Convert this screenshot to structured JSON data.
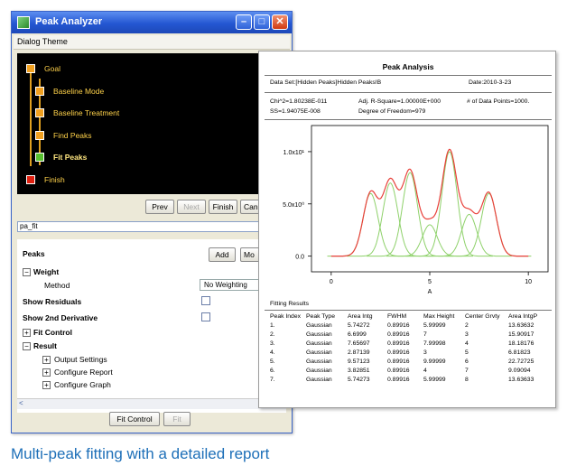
{
  "window": {
    "title": "Peak Analyzer",
    "theme_label": "Dialog Theme",
    "steps": [
      {
        "label": "Goal",
        "color": "#f0a020"
      },
      {
        "label": "Baseline Mode",
        "color": "#f0a020"
      },
      {
        "label": "Baseline Treatment",
        "color": "#f0a020"
      },
      {
        "label": "Find Peaks",
        "color": "#f0a020"
      },
      {
        "label": "Fit Peaks",
        "color": "#58c030"
      },
      {
        "label": "Finish",
        "color": "#e02010"
      }
    ],
    "nav": {
      "prev": "Prev",
      "next": "Next",
      "finish": "Finish",
      "cancel": "Canc"
    },
    "theme_name": "pa_fit",
    "peaks_label": "Peaks",
    "add_label": "Add",
    "more_label": "Mo",
    "weight_label": "Weight",
    "method_label": "Method",
    "method_value": "No Weighting",
    "show_residuals": "Show Residuals",
    "show_2nd_derivative": "Show 2nd Derivative",
    "fit_control": "Fit Control",
    "result": "Result",
    "result_items": [
      "Output Settings",
      "Configure Report",
      "Configure Graph"
    ],
    "bottom_fit_control": "Fit Control",
    "bottom_fit": "Fit"
  },
  "report": {
    "title": "Peak Analysis",
    "data_set": "Data Set:[Hidden Peaks]Hidden Peaks!B",
    "date": "Date:2010-3-23",
    "chi2": "Chi^2=1.80238E-011",
    "adj_r2": "Adj. R-Square=1.00000E+000",
    "num_points": "# of Data Points=1000.",
    "ss": "SS=1.94075E-008",
    "dof": "Degree of Freedom=979",
    "fitting_results": "Fitting Results",
    "columns": [
      "Peak Index",
      "Peak Type",
      "Area Intg",
      "FWHM",
      "Max Height",
      "Center Grvty",
      "Area IntgP"
    ],
    "rows": [
      [
        "1.",
        "Gaussian",
        "5.74272",
        "0.89916",
        "5.99999",
        "2",
        "13.63632"
      ],
      [
        "2.",
        "Gaussian",
        "6.6999",
        "0.89916",
        "7",
        "3",
        "15.90917"
      ],
      [
        "3.",
        "Gaussian",
        "7.65697",
        "0.89916",
        "7.99998",
        "4",
        "18.18176"
      ],
      [
        "4.",
        "Gaussian",
        "2.87139",
        "0.89916",
        "3",
        "5",
        "6.81823"
      ],
      [
        "5.",
        "Gaussian",
        "9.57123",
        "0.89916",
        "9.99999",
        "6",
        "22.72725"
      ],
      [
        "6.",
        "Gaussian",
        "3.82851",
        "0.89916",
        "4",
        "7",
        "9.09094"
      ],
      [
        "7.",
        "Gaussian",
        "5.74273",
        "0.89916",
        "5.99999",
        "8",
        "13.63633"
      ]
    ]
  },
  "chart_data": {
    "type": "line",
    "title": "",
    "xlabel": "A",
    "ylabel": "",
    "xlim": [
      -1,
      11
    ],
    "ylim": [
      -1.5,
      12.5
    ],
    "x_ticks": [
      0,
      5,
      10
    ],
    "y_tick_labels": [
      "1.0x10¹",
      "5.0x10⁰",
      "0.0"
    ],
    "y_tick_values": [
      10,
      5,
      0
    ],
    "series": [
      {
        "type": "sum",
        "color": "#e8403a"
      },
      {
        "type": "components",
        "color": "#8ed16a"
      }
    ],
    "peaks": [
      {
        "center": 2,
        "height": 6,
        "fwhm": 0.89916
      },
      {
        "center": 3,
        "height": 7,
        "fwhm": 0.89916
      },
      {
        "center": 4,
        "height": 8,
        "fwhm": 0.89916
      },
      {
        "center": 5,
        "height": 3,
        "fwhm": 0.89916
      },
      {
        "center": 6,
        "height": 10,
        "fwhm": 0.89916
      },
      {
        "center": 7,
        "height": 4,
        "fwhm": 0.89916
      },
      {
        "center": 8,
        "height": 6,
        "fwhm": 0.89916
      }
    ]
  },
  "caption": "Multi-peak fitting with a detailed report"
}
